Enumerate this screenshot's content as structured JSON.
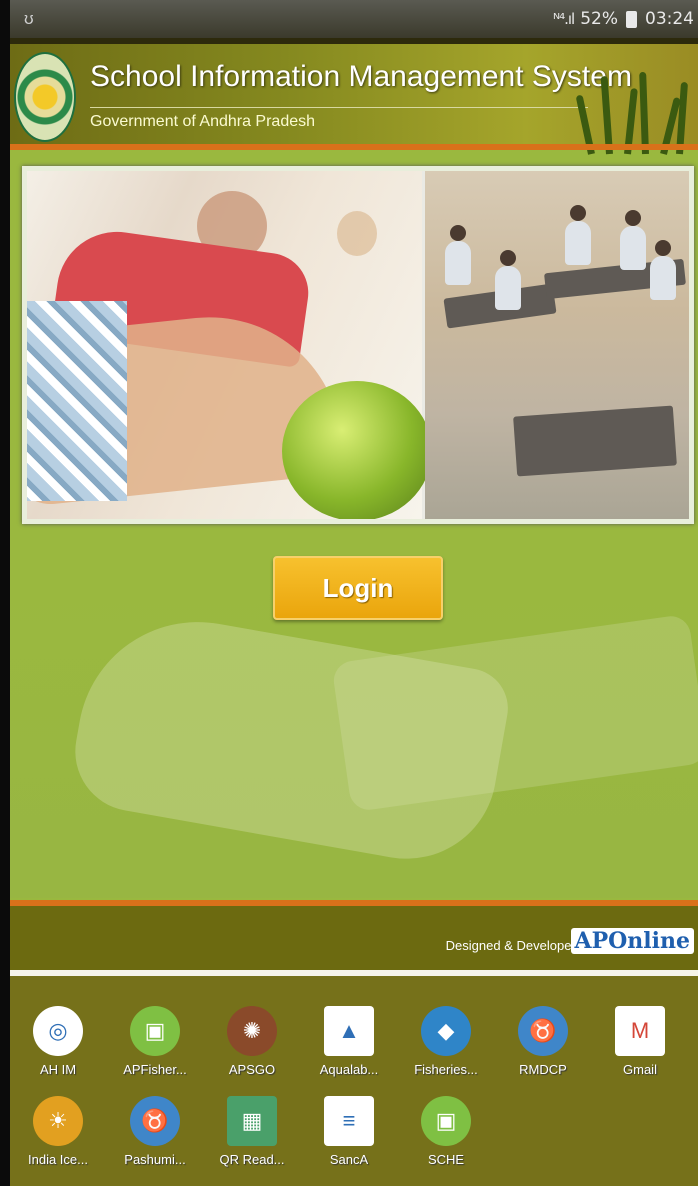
{
  "status_bar": {
    "notification": "ʊ",
    "signal": "ᴺ⁴.ıl",
    "battery": "52%",
    "time": "03:24"
  },
  "app": {
    "title": "School Information Management System",
    "subtitle": "Government of Andhra Pradesh",
    "login_label": "Login",
    "footer_credit": "Designed & Developed by",
    "footer_logo": "APOnline"
  },
  "dock": {
    "row1": [
      {
        "label": "AH IM",
        "icon": "map-pin-icon",
        "color": "#ffffff"
      },
      {
        "label": "APFisher...",
        "icon": "android-icon",
        "color": "#7fc043"
      },
      {
        "label": "APSGO",
        "icon": "cattle-icon",
        "color": "#8a4a2a"
      },
      {
        "label": "Aqualab...",
        "icon": "flask-icon",
        "color": "#ffffff"
      },
      {
        "label": "Fisheries...",
        "icon": "fish-icon",
        "color": "#2f85c8"
      },
      {
        "label": "RMDCP",
        "icon": "cow-icon",
        "color": "#3f86c9"
      },
      {
        "label": "Gmail",
        "icon": "gmail-icon",
        "color": "#ffffff"
      }
    ],
    "row2": [
      {
        "label": "India Ice...",
        "icon": "sun-icon",
        "color": "#e2a020"
      },
      {
        "label": "Pashumi...",
        "icon": "cow-icon",
        "color": "#3f86c9"
      },
      {
        "label": "QR Read...",
        "icon": "qr-icon",
        "color": "#4aa06a"
      },
      {
        "label": "SancA",
        "icon": "sanca-icon",
        "color": "#ffffff"
      },
      {
        "label": "SCHE",
        "icon": "android-icon",
        "color": "#7fc043"
      }
    ]
  }
}
